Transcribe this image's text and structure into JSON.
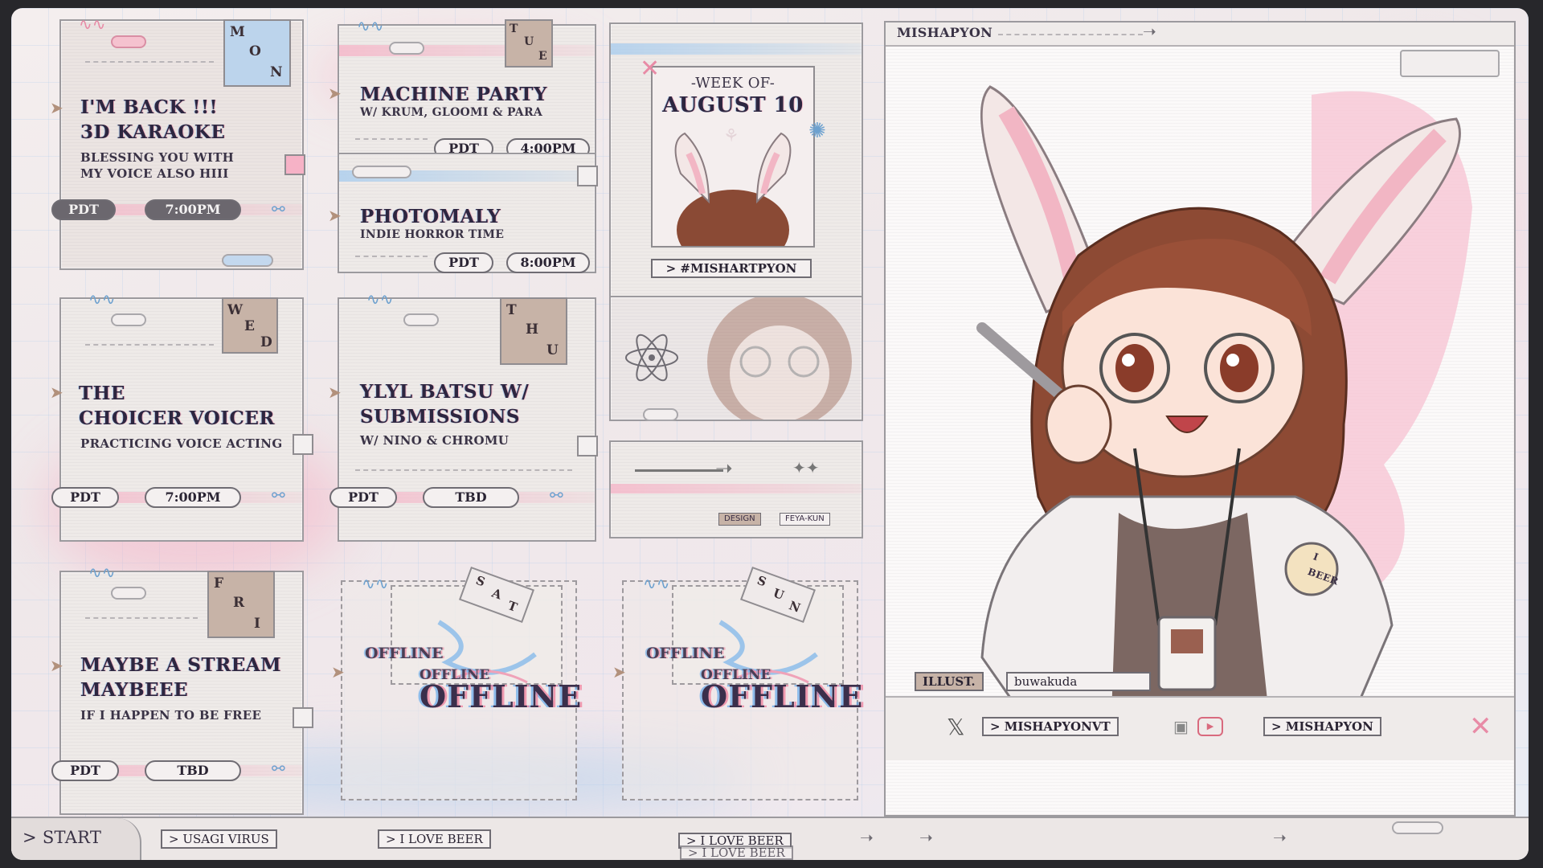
{
  "header": {
    "streamer_name": "MISHAPYON"
  },
  "week": {
    "label": "-WEEK OF-",
    "date": "AUGUST 10",
    "hashtag": "> #MISHARTPYON"
  },
  "days": [
    {
      "letters": [
        "M",
        "O",
        "N"
      ],
      "title": [
        "I'M BACK !!!",
        "3D KARAOKE"
      ],
      "subtitle": [
        "BLESSING YOU WITH",
        "MY VOICE ALSO HIII"
      ],
      "tz": "PDT",
      "time": "7:00PM"
    },
    {
      "letters": [
        "T",
        "U",
        "E"
      ],
      "title": [
        "MACHINE PARTY"
      ],
      "subtitle": [
        "W/ KRUM, GLOOMI & PARA"
      ],
      "tz": "PDT",
      "time": "4:00PM"
    },
    {
      "title": [
        "PHOTOMALY"
      ],
      "subtitle": [
        "INDIE HORROR TIME"
      ],
      "tz": "PDT",
      "time": "8:00PM"
    },
    {
      "letters": [
        "W",
        "E",
        "D"
      ],
      "title": [
        "THE",
        "CHOICER VOICER"
      ],
      "subtitle": [
        "PRACTICING VOICE ACTING"
      ],
      "tz": "PDT",
      "time": "7:00PM"
    },
    {
      "letters": [
        "T",
        "H",
        "U"
      ],
      "title": [
        "YLYL BATSU W/",
        "SUBMISSIONS"
      ],
      "subtitle": [
        "W/ NINO & CHROMU"
      ],
      "tz": "PDT",
      "time": "TBD"
    },
    {
      "letters": [
        "F",
        "R",
        "I"
      ],
      "title": [
        "MAYBE A STREAM",
        "MAYBEEE"
      ],
      "subtitle": [
        "IF I HAPPEN TO BE FREE"
      ],
      "tz": "PDT",
      "time": "TBD"
    },
    {
      "letters": [
        "S",
        "A",
        "T"
      ],
      "status_small": "OFFLINE",
      "status_mid": "OFFLINE",
      "status": "OFFLINE"
    },
    {
      "letters": [
        "S",
        "U",
        "N"
      ],
      "status_small": "OFFLINE",
      "status_mid": "OFFLINE",
      "status": "OFFLINE"
    }
  ],
  "credits": {
    "design_label": "DESIGN",
    "designer": "FEYA-KUN",
    "illust_label": "ILLUST.",
    "illustrator": "buwakuda"
  },
  "socials": {
    "twitter": "> MISHAPYONVT",
    "twitch_youtube": "> MISHAPYON"
  },
  "badge": {
    "text": [
      "I",
      "BEER"
    ]
  },
  "taskbar": {
    "start": "> START",
    "items": [
      "> USAGI VIRUS",
      "> I LOVE BEER",
      "> I LOVE BEER",
      "> I LOVE BEER"
    ]
  },
  "colors": {
    "pink": "#f6b2c6",
    "blue": "#aacdee",
    "tan": "#c7b3a7",
    "ink": "#2d2640"
  }
}
